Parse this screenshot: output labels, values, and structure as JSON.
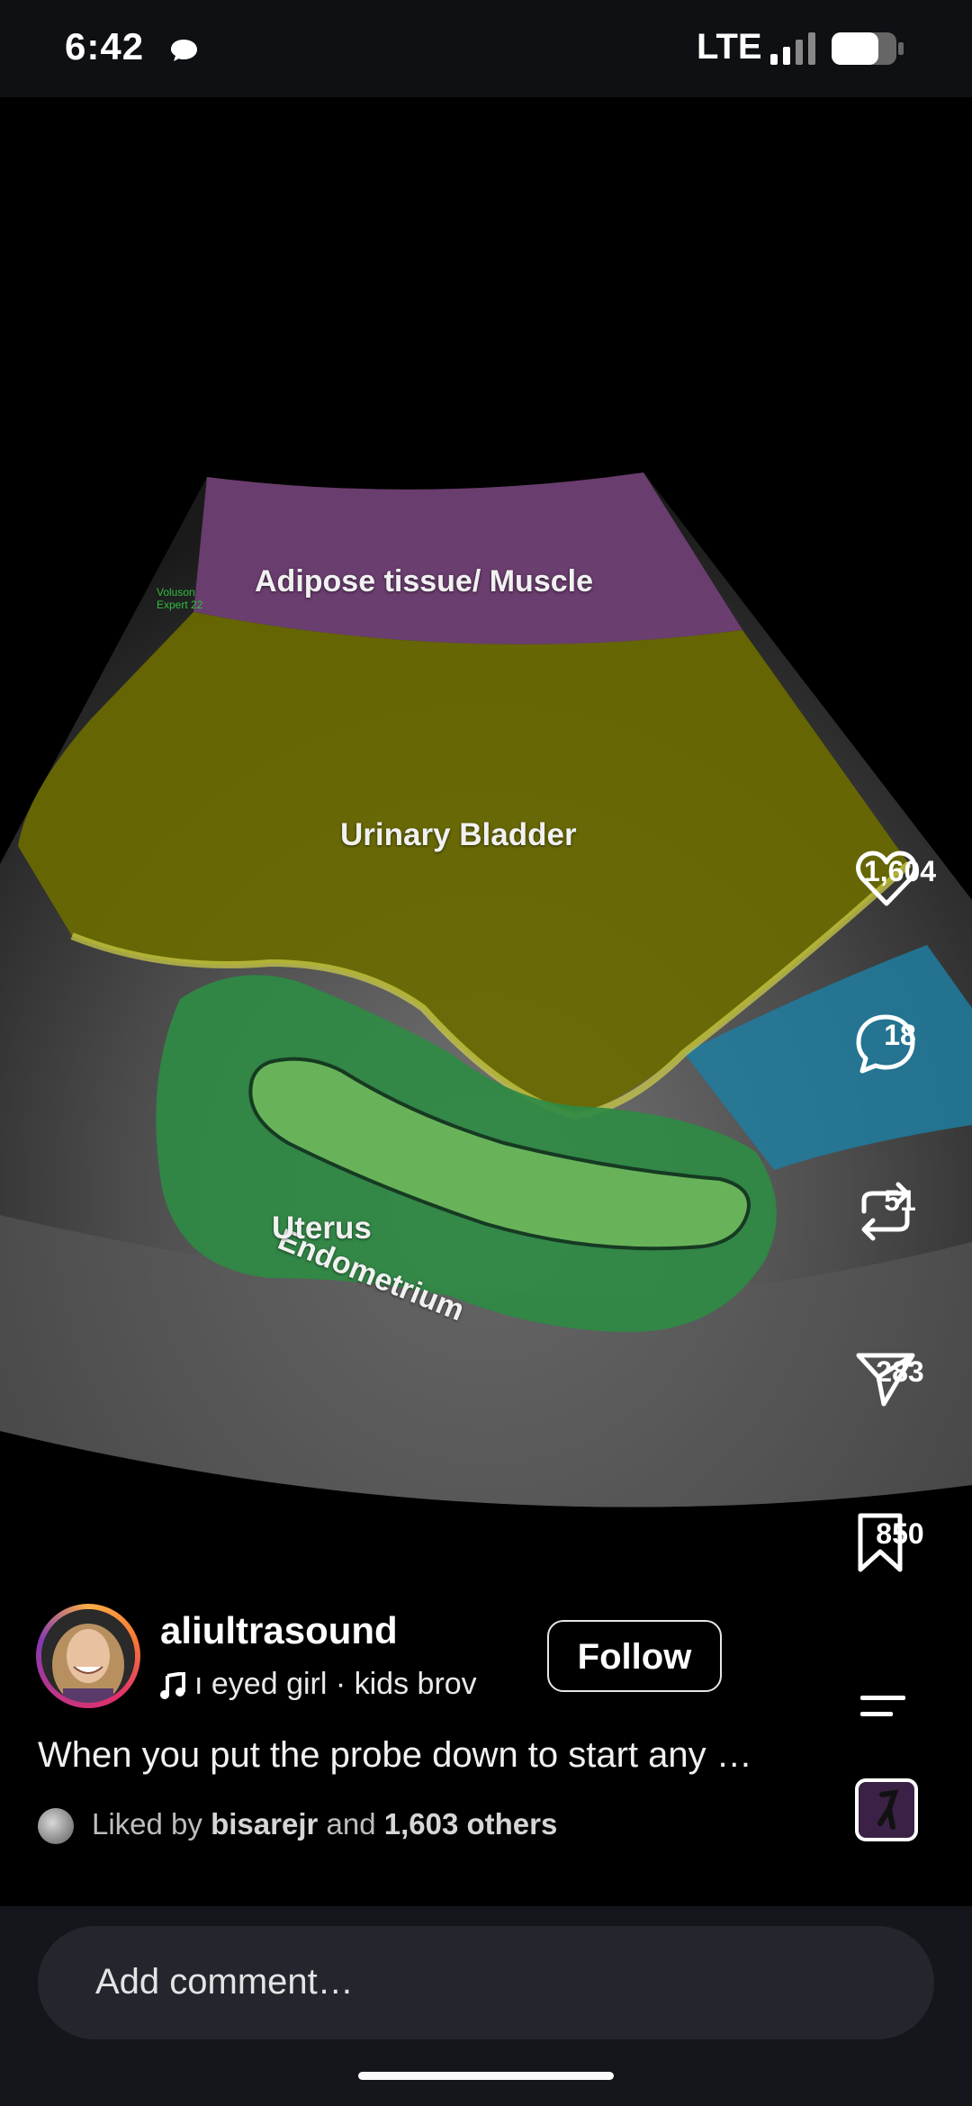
{
  "status_bar": {
    "time": "6:42",
    "network": "LTE",
    "icons": [
      "message-bubble-icon",
      "signal-bars-icon",
      "battery-icon"
    ]
  },
  "video": {
    "brand_watermark": "Voluson\nExpert 22",
    "labels": {
      "adipose": "Adipose tissue/ Muscle",
      "bladder": "Urinary Bladder",
      "endometrium": "Endometrium",
      "uterus": "Uterus"
    },
    "colors": {
      "adipose": "#6e3f72",
      "bladder": "#6a6a00",
      "uterus": "#2f8a44",
      "endometrium": "#68b35a",
      "right_region": "#1f7ca0"
    }
  },
  "actions": {
    "like_count": "1,604",
    "comment_count": "18",
    "repost_count": "51",
    "share_count": "283",
    "save_count": "850",
    "icons": [
      "heart-icon",
      "comment-icon",
      "repost-icon",
      "send-icon",
      "bookmark-icon",
      "more-icon",
      "audio-thumbnail-icon"
    ]
  },
  "post": {
    "username": "aliultrasound",
    "audio_text": "ı eyed girl · kids   brov",
    "follow_label": "Follow",
    "caption": "When you put the probe down to start any …",
    "likes": {
      "prefix": "Liked by",
      "first_liker": "bisarejr",
      "connector": "and",
      "others": "1,603 others"
    }
  },
  "comment": {
    "placeholder": "Add comment…"
  }
}
